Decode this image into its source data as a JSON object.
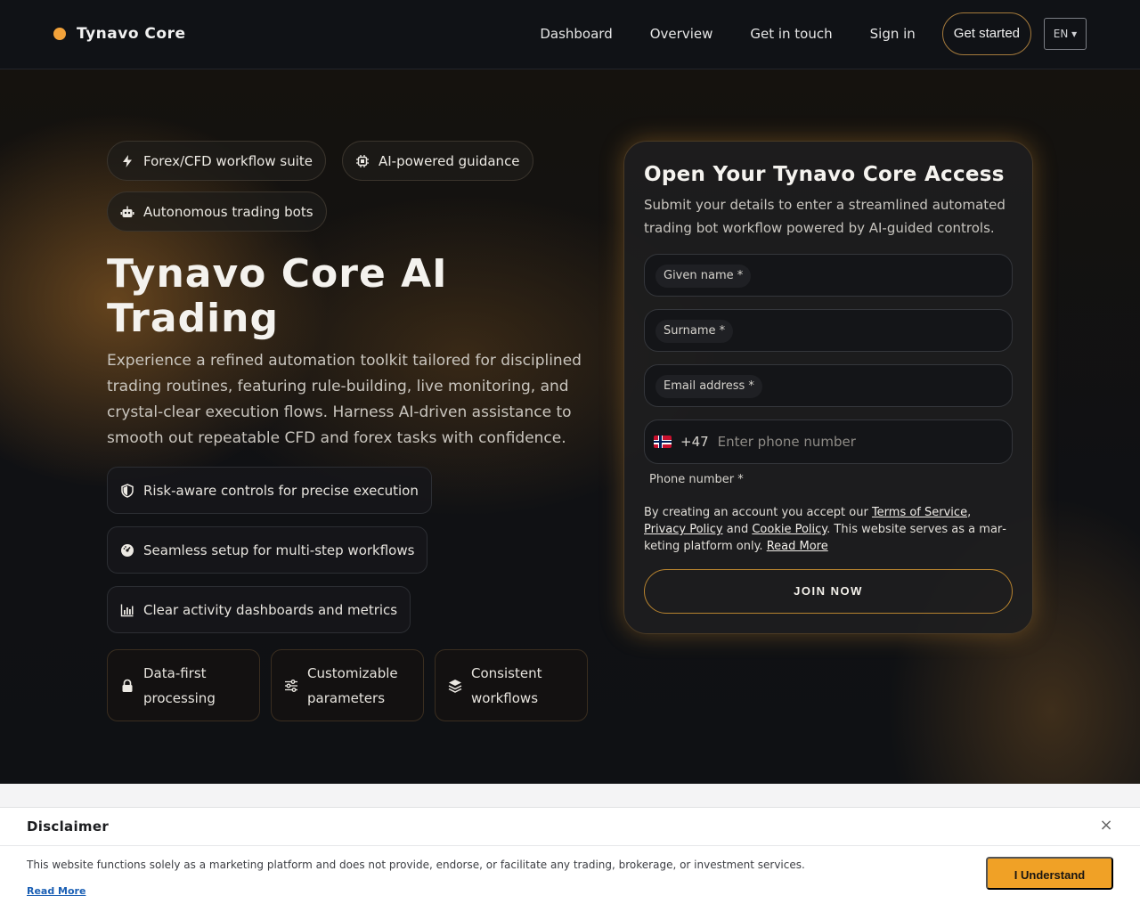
{
  "header": {
    "brand": "Tynavo Core",
    "nav": [
      "Dashboard",
      "Overview",
      "Get in touch",
      "Sign in"
    ],
    "cta": "Get started",
    "language": "EN ▾"
  },
  "hero": {
    "pills": [
      "Forex/CFD workflow suite",
      "AI-powered guidance",
      "Autonomous trading bots"
    ],
    "title": "Tynavo Core AI Trading",
    "description": "Experience a refined automation toolkit tailored for disciplined trading routines, featuring rule-building, live monitoring, and crystal-clear execution flows. Harness AI-driven assistance to smooth out repeatable CFD and forex tasks with confidence.",
    "features": [
      "Risk-aware controls for precise execution",
      "Seamless setup for multi-step workflows",
      "Clear activity dashboards and metrics"
    ],
    "cards": [
      "Data-first processing",
      "Customizable parameters",
      "Consistent workflows"
    ]
  },
  "form": {
    "title": "Open Your Tynavo Core Access",
    "subtitle": "Submit your details to enter a streamlined automated trading bot workflow powered by AI-guided controls.",
    "given_name_label": "Given name *",
    "surname_label": "Surname *",
    "email_label": "Email address *",
    "dial_code": "+47",
    "phone_placeholder": "Enter phone number",
    "phone_label": "Phone number *",
    "terms_prefix": "By creating an account you accept our ",
    "terms_link": "Terms of Service",
    "terms_comma": ",",
    "privacy_link": "Privacy Policy",
    "terms_and": " and ",
    "cookie_link": "Cookie Policy",
    "terms_suffix": ". This website serves as a mar­keting platform only. ",
    "read_more_link": "Read More",
    "submit": "JOIN NOW"
  },
  "disclaimer": {
    "title": "Disclaimer",
    "close": "×",
    "text": "This website functions solely as a marketing platform and does not provide, endorse, or facilitate any trading, brokerage, or investment services.",
    "read_more": "Read More",
    "button": "I Understand"
  },
  "colors": {
    "accent": "#f0a126",
    "brand_dot": "#f2a23a",
    "background": "#0d0f12"
  }
}
